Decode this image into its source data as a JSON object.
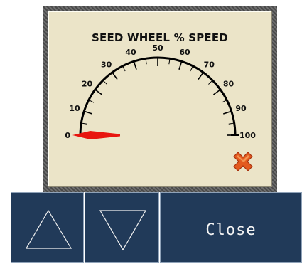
{
  "gauge": {
    "title": "SEED WHEEL % SPEED",
    "min": 0,
    "max": 100,
    "value": 0,
    "major_ticks": [
      0,
      10,
      20,
      30,
      40,
      50,
      60,
      70,
      80,
      90,
      100
    ],
    "tick_labels": [
      "0",
      "10",
      "20",
      "30",
      "40",
      "50",
      "60",
      "70",
      "80",
      "90",
      "100"
    ],
    "needle_color": "#e8150f",
    "panel_color": "#ebe4c8",
    "status_icon": "red-x-icon"
  },
  "buttons": {
    "up_icon": "up-triangle-icon",
    "down_icon": "down-triangle-icon",
    "close_label": "Close",
    "color": "#213a59"
  }
}
